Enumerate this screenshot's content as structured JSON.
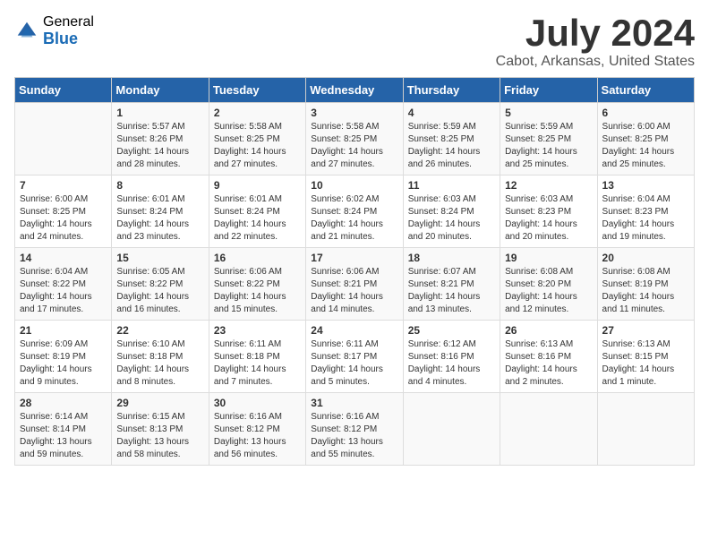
{
  "logo": {
    "general": "General",
    "blue": "Blue"
  },
  "title": "July 2024",
  "location": "Cabot, Arkansas, United States",
  "weekdays": [
    "Sunday",
    "Monday",
    "Tuesday",
    "Wednesday",
    "Thursday",
    "Friday",
    "Saturday"
  ],
  "weeks": [
    [
      {
        "day": "",
        "info": ""
      },
      {
        "day": "1",
        "info": "Sunrise: 5:57 AM\nSunset: 8:26 PM\nDaylight: 14 hours\nand 28 minutes."
      },
      {
        "day": "2",
        "info": "Sunrise: 5:58 AM\nSunset: 8:25 PM\nDaylight: 14 hours\nand 27 minutes."
      },
      {
        "day": "3",
        "info": "Sunrise: 5:58 AM\nSunset: 8:25 PM\nDaylight: 14 hours\nand 27 minutes."
      },
      {
        "day": "4",
        "info": "Sunrise: 5:59 AM\nSunset: 8:25 PM\nDaylight: 14 hours\nand 26 minutes."
      },
      {
        "day": "5",
        "info": "Sunrise: 5:59 AM\nSunset: 8:25 PM\nDaylight: 14 hours\nand 25 minutes."
      },
      {
        "day": "6",
        "info": "Sunrise: 6:00 AM\nSunset: 8:25 PM\nDaylight: 14 hours\nand 25 minutes."
      }
    ],
    [
      {
        "day": "7",
        "info": "Sunrise: 6:00 AM\nSunset: 8:25 PM\nDaylight: 14 hours\nand 24 minutes."
      },
      {
        "day": "8",
        "info": "Sunrise: 6:01 AM\nSunset: 8:24 PM\nDaylight: 14 hours\nand 23 minutes."
      },
      {
        "day": "9",
        "info": "Sunrise: 6:01 AM\nSunset: 8:24 PM\nDaylight: 14 hours\nand 22 minutes."
      },
      {
        "day": "10",
        "info": "Sunrise: 6:02 AM\nSunset: 8:24 PM\nDaylight: 14 hours\nand 21 minutes."
      },
      {
        "day": "11",
        "info": "Sunrise: 6:03 AM\nSunset: 8:24 PM\nDaylight: 14 hours\nand 20 minutes."
      },
      {
        "day": "12",
        "info": "Sunrise: 6:03 AM\nSunset: 8:23 PM\nDaylight: 14 hours\nand 20 minutes."
      },
      {
        "day": "13",
        "info": "Sunrise: 6:04 AM\nSunset: 8:23 PM\nDaylight: 14 hours\nand 19 minutes."
      }
    ],
    [
      {
        "day": "14",
        "info": "Sunrise: 6:04 AM\nSunset: 8:22 PM\nDaylight: 14 hours\nand 17 minutes."
      },
      {
        "day": "15",
        "info": "Sunrise: 6:05 AM\nSunset: 8:22 PM\nDaylight: 14 hours\nand 16 minutes."
      },
      {
        "day": "16",
        "info": "Sunrise: 6:06 AM\nSunset: 8:22 PM\nDaylight: 14 hours\nand 15 minutes."
      },
      {
        "day": "17",
        "info": "Sunrise: 6:06 AM\nSunset: 8:21 PM\nDaylight: 14 hours\nand 14 minutes."
      },
      {
        "day": "18",
        "info": "Sunrise: 6:07 AM\nSunset: 8:21 PM\nDaylight: 14 hours\nand 13 minutes."
      },
      {
        "day": "19",
        "info": "Sunrise: 6:08 AM\nSunset: 8:20 PM\nDaylight: 14 hours\nand 12 minutes."
      },
      {
        "day": "20",
        "info": "Sunrise: 6:08 AM\nSunset: 8:19 PM\nDaylight: 14 hours\nand 11 minutes."
      }
    ],
    [
      {
        "day": "21",
        "info": "Sunrise: 6:09 AM\nSunset: 8:19 PM\nDaylight: 14 hours\nand 9 minutes."
      },
      {
        "day": "22",
        "info": "Sunrise: 6:10 AM\nSunset: 8:18 PM\nDaylight: 14 hours\nand 8 minutes."
      },
      {
        "day": "23",
        "info": "Sunrise: 6:11 AM\nSunset: 8:18 PM\nDaylight: 14 hours\nand 7 minutes."
      },
      {
        "day": "24",
        "info": "Sunrise: 6:11 AM\nSunset: 8:17 PM\nDaylight: 14 hours\nand 5 minutes."
      },
      {
        "day": "25",
        "info": "Sunrise: 6:12 AM\nSunset: 8:16 PM\nDaylight: 14 hours\nand 4 minutes."
      },
      {
        "day": "26",
        "info": "Sunrise: 6:13 AM\nSunset: 8:16 PM\nDaylight: 14 hours\nand 2 minutes."
      },
      {
        "day": "27",
        "info": "Sunrise: 6:13 AM\nSunset: 8:15 PM\nDaylight: 14 hours\nand 1 minute."
      }
    ],
    [
      {
        "day": "28",
        "info": "Sunrise: 6:14 AM\nSunset: 8:14 PM\nDaylight: 13 hours\nand 59 minutes."
      },
      {
        "day": "29",
        "info": "Sunrise: 6:15 AM\nSunset: 8:13 PM\nDaylight: 13 hours\nand 58 minutes."
      },
      {
        "day": "30",
        "info": "Sunrise: 6:16 AM\nSunset: 8:12 PM\nDaylight: 13 hours\nand 56 minutes."
      },
      {
        "day": "31",
        "info": "Sunrise: 6:16 AM\nSunset: 8:12 PM\nDaylight: 13 hours\nand 55 minutes."
      },
      {
        "day": "",
        "info": ""
      },
      {
        "day": "",
        "info": ""
      },
      {
        "day": "",
        "info": ""
      }
    ]
  ]
}
